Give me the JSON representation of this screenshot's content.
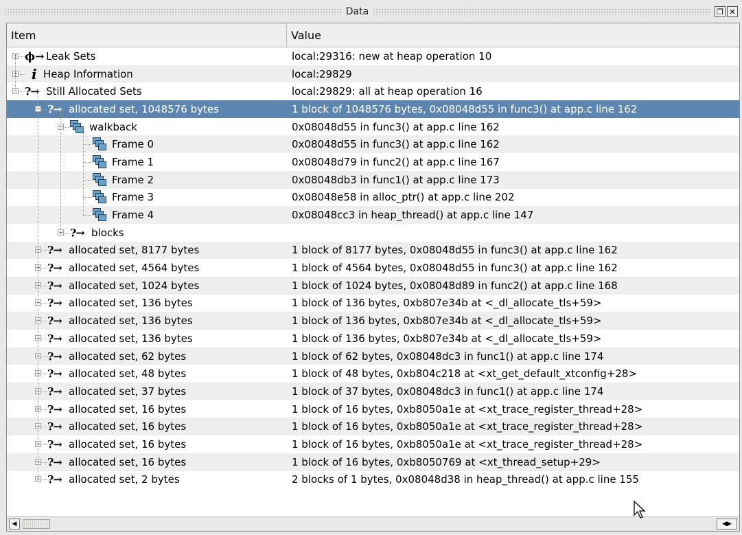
{
  "window": {
    "title": "Data"
  },
  "table": {
    "headers": {
      "item": "Item",
      "value": "Value"
    },
    "rows": [
      {
        "depth": 0,
        "expander": "plus",
        "icon": "leak-sets-icon",
        "label": "Leak Sets",
        "value": "local:29316: new at heap operation 10"
      },
      {
        "depth": 0,
        "expander": "plus",
        "icon": "info-icon",
        "label": "Heap Information",
        "value": "local:29829"
      },
      {
        "depth": 0,
        "expander": "minus",
        "icon": "allocated-icon",
        "label": "Still Allocated Sets",
        "value": "local:29829: all at heap operation 16"
      },
      {
        "depth": 1,
        "expander": "minus",
        "icon": "allocated-icon",
        "label": "allocated set, 1048576 bytes",
        "value": "1 block of 1048576 bytes, 0x08048d55 in func3() at app.c line 162",
        "selected": true
      },
      {
        "depth": 2,
        "expander": "minus",
        "icon": "stack-frames-icon",
        "label": "walkback",
        "value": "0x08048d55 in func3() at app.c line 162"
      },
      {
        "depth": 3,
        "expander": "none",
        "icon": "stack-frames-icon",
        "label": "Frame 0",
        "value": "0x08048d55 in func3() at app.c line 162"
      },
      {
        "depth": 3,
        "expander": "none",
        "icon": "stack-frames-icon",
        "label": "Frame 1",
        "value": "0x08048d79 in func2() at app.c line 167"
      },
      {
        "depth": 3,
        "expander": "none",
        "icon": "stack-frames-icon",
        "label": "Frame 2",
        "value": "0x08048db3 in func1() at app.c line 173"
      },
      {
        "depth": 3,
        "expander": "none",
        "icon": "stack-frames-icon",
        "label": "Frame 3",
        "value": "0x08048e58 in alloc_ptr() at app.c line 202"
      },
      {
        "depth": 3,
        "expander": "none",
        "icon": "stack-frames-icon",
        "label": "Frame 4",
        "value": "0x08048cc3 in heap_thread() at app.c line 147"
      },
      {
        "depth": 2,
        "expander": "plus",
        "icon": "allocated-icon",
        "label": "blocks",
        "value": ""
      },
      {
        "depth": 1,
        "expander": "plus",
        "icon": "allocated-icon",
        "label": "allocated set, 8177 bytes",
        "value": "1 block of 8177 bytes, 0x08048d55 in func3() at app.c line 162"
      },
      {
        "depth": 1,
        "expander": "plus",
        "icon": "allocated-icon",
        "label": "allocated set, 4564 bytes",
        "value": "1 block of 4564 bytes, 0x08048d55 in func3() at app.c line 162"
      },
      {
        "depth": 1,
        "expander": "plus",
        "icon": "allocated-icon",
        "label": "allocated set, 1024 bytes",
        "value": "1 block of 1024 bytes, 0x08048d89 in func2() at app.c line 168"
      },
      {
        "depth": 1,
        "expander": "plus",
        "icon": "allocated-icon",
        "label": "allocated set, 136 bytes",
        "value": "1 block of 136 bytes, 0xb807e34b at <_dl_allocate_tls+59>"
      },
      {
        "depth": 1,
        "expander": "plus",
        "icon": "allocated-icon",
        "label": "allocated set, 136 bytes",
        "value": "1 block of 136 bytes, 0xb807e34b at <_dl_allocate_tls+59>"
      },
      {
        "depth": 1,
        "expander": "plus",
        "icon": "allocated-icon",
        "label": "allocated set, 136 bytes",
        "value": "1 block of 136 bytes, 0xb807e34b at <_dl_allocate_tls+59>"
      },
      {
        "depth": 1,
        "expander": "plus",
        "icon": "allocated-icon",
        "label": "allocated set, 62 bytes",
        "value": "1 block of 62 bytes, 0x08048dc3 in func1() at app.c line 174"
      },
      {
        "depth": 1,
        "expander": "plus",
        "icon": "allocated-icon",
        "label": "allocated set, 48 bytes",
        "value": "1 block of 48 bytes, 0xb804c218 at <xt_get_default_xtconfig+28>"
      },
      {
        "depth": 1,
        "expander": "plus",
        "icon": "allocated-icon",
        "label": "allocated set, 37 bytes",
        "value": "1 block of 37 bytes, 0x08048dc3 in func1() at app.c line 174"
      },
      {
        "depth": 1,
        "expander": "plus",
        "icon": "allocated-icon",
        "label": "allocated set, 16 bytes",
        "value": "1 block of 16 bytes, 0xb8050a1e at <xt_trace_register_thread+28>"
      },
      {
        "depth": 1,
        "expander": "plus",
        "icon": "allocated-icon",
        "label": "allocated set, 16 bytes",
        "value": "1 block of 16 bytes, 0xb8050a1e at <xt_trace_register_thread+28>"
      },
      {
        "depth": 1,
        "expander": "plus",
        "icon": "allocated-icon",
        "label": "allocated set, 16 bytes",
        "value": "1 block of 16 bytes, 0xb8050a1e at <xt_trace_register_thread+28>"
      },
      {
        "depth": 1,
        "expander": "plus",
        "icon": "allocated-icon",
        "label": "allocated set, 16 bytes",
        "value": "1 block of 16 bytes, 0xb8050769 at <xt_thread_setup+29>"
      },
      {
        "depth": 1,
        "expander": "plus",
        "icon": "allocated-icon",
        "label": "allocated set, 2 bytes",
        "value": "2 blocks of 1 bytes, 0x08048d38 in heap_thread() at app.c line 155"
      }
    ]
  },
  "glyphs": {
    "allocated-icon": "?→",
    "leak-sets-icon": "ϕ→",
    "info-icon": "i",
    "float_button": "❐",
    "close_button": "✕",
    "scroll_left": "◀",
    "scroll_right": "◀▶"
  }
}
